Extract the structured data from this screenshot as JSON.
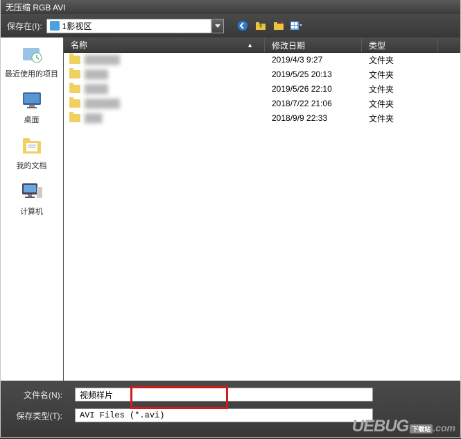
{
  "titlebar": {
    "text": "无压缩 RGB AVI"
  },
  "toolbar": {
    "save_in_label": "保存在(I):",
    "path_value": "1影视区"
  },
  "sidebar": {
    "items": [
      {
        "label": "最近使用的项目"
      },
      {
        "label": "桌面"
      },
      {
        "label": "我的文档"
      },
      {
        "label": "计算机"
      }
    ]
  },
  "columns": {
    "name": "名称",
    "date": "修改日期",
    "type": "类型"
  },
  "rows": [
    {
      "date": "2019/4/3 9:27",
      "type": "文件夹"
    },
    {
      "date": "2019/5/25 20:13",
      "type": "文件夹"
    },
    {
      "date": "2019/5/26 22:10",
      "type": "文件夹"
    },
    {
      "date": "2018/7/22 21:06",
      "type": "文件夹"
    },
    {
      "date": "2018/9/9 22:33",
      "type": "文件夹"
    }
  ],
  "footer": {
    "filename_label": "文件名(N):",
    "filename_value": "视频样片",
    "filetype_label": "保存类型(T):",
    "filetype_value": "AVI Files (*.avi)"
  },
  "watermark": {
    "brand": "UEBUG",
    "tag": "下载站",
    "suffix": ".com"
  }
}
